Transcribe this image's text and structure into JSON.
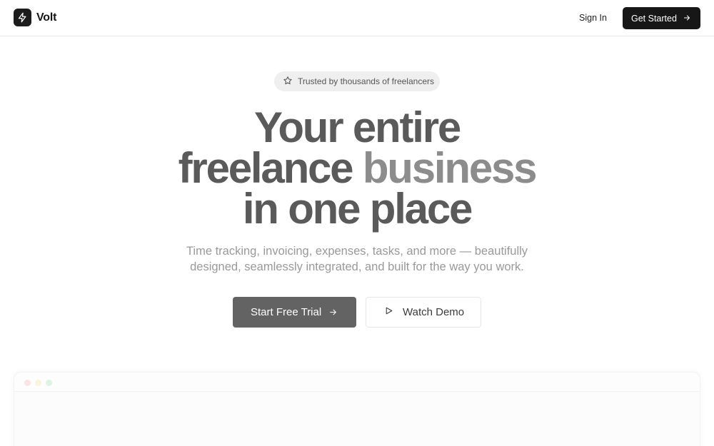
{
  "header": {
    "brand": "Volt",
    "logo_icon": "bolt-icon",
    "signin_label": "Sign In",
    "get_started_label": "Get Started"
  },
  "hero": {
    "badge_icon": "star-icon",
    "badge_text": "Trusted by thousands of freelancers",
    "headline_line1": "Your entire",
    "headline_line2a": "freelance",
    "headline_line2b": "business",
    "headline_line3": "in one place",
    "subtitle": "Time tracking, invoicing, expenses, tasks, and more — beautifully designed, seamlessly integrated, and built for the way you work.",
    "primary_cta": "Start Free Trial",
    "secondary_cta": "Watch Demo"
  },
  "colors": {
    "dark": "#171717",
    "primary_button": "#636363",
    "headline": "#5a5a5a",
    "headline_light": "#8c8c8c",
    "dot_red": "#fbe3e3",
    "dot_yellow": "#fbf3da",
    "dot_green": "#def4e3"
  }
}
